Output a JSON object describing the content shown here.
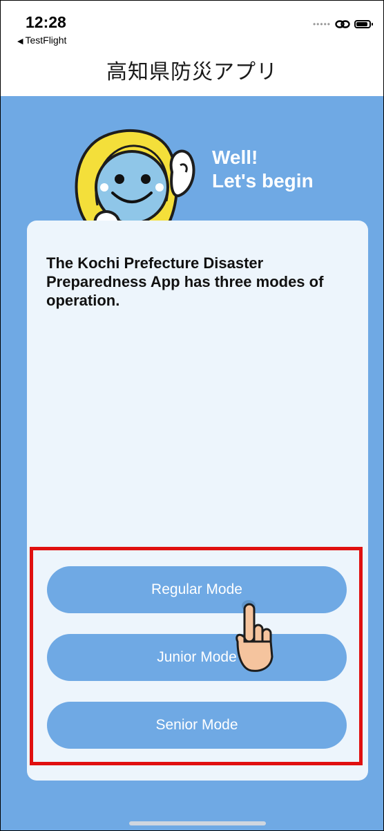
{
  "status_bar": {
    "time": "12:28",
    "back_app": "TestFlight",
    "back_arrow": "◀"
  },
  "header": {
    "title": "高知県防災アプリ"
  },
  "greeting": {
    "line1": "Well!",
    "line2": "Let's begin"
  },
  "card": {
    "intro": "The Kochi Prefecture Disaster Preparedness App has three modes of operation."
  },
  "modes": [
    {
      "label": "Regular Mode"
    },
    {
      "label": "Junior Mode"
    },
    {
      "label": "Senior Mode"
    }
  ],
  "colors": {
    "background": "#6fa9e4",
    "card": "#edf5fc",
    "button": "#6fa9e4",
    "highlight": "#e01010"
  }
}
